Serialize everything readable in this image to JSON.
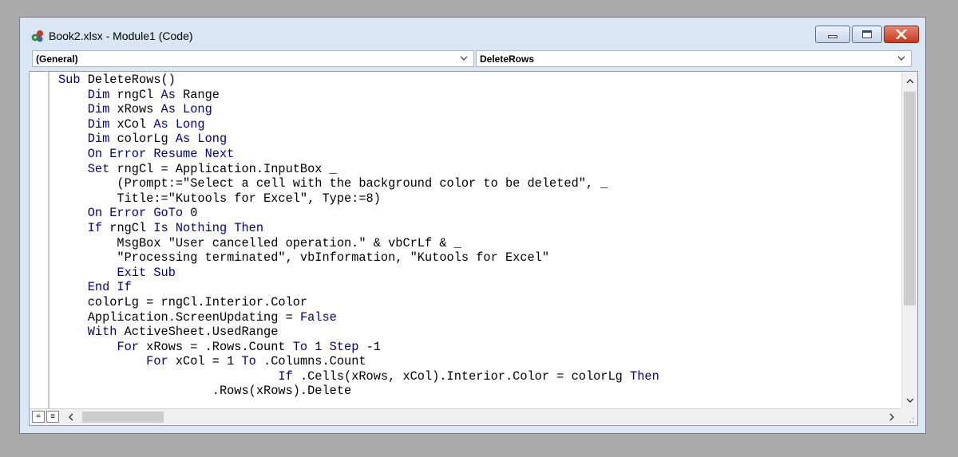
{
  "window": {
    "title": "Book2.xlsx - Module1 (Code)"
  },
  "toolbar": {
    "object_combo": "(General)",
    "procedure_combo": "DeleteRows"
  },
  "code": {
    "lines": [
      [
        [
          "kw",
          "Sub "
        ],
        [
          "t",
          "DeleteRows()"
        ]
      ],
      [
        [
          "t",
          "    "
        ],
        [
          "kw",
          "Dim "
        ],
        [
          "t",
          "rngCl "
        ],
        [
          "kw",
          "As "
        ],
        [
          "t",
          "Range"
        ]
      ],
      [
        [
          "t",
          "    "
        ],
        [
          "kw",
          "Dim "
        ],
        [
          "t",
          "xRows "
        ],
        [
          "kw",
          "As Long"
        ]
      ],
      [
        [
          "t",
          "    "
        ],
        [
          "kw",
          "Dim "
        ],
        [
          "t",
          "xCol "
        ],
        [
          "kw",
          "As Long"
        ]
      ],
      [
        [
          "t",
          "    "
        ],
        [
          "kw",
          "Dim "
        ],
        [
          "t",
          "colorLg "
        ],
        [
          "kw",
          "As Long"
        ]
      ],
      [
        [
          "t",
          "    "
        ],
        [
          "kw",
          "On Error Resume Next"
        ]
      ],
      [
        [
          "t",
          "    "
        ],
        [
          "kw",
          "Set "
        ],
        [
          "t",
          "rngCl = Application.InputBox _"
        ]
      ],
      [
        [
          "t",
          "        (Prompt:=\"Select a cell with the background color to be deleted\", _"
        ]
      ],
      [
        [
          "t",
          "        Title:=\"Kutools for Excel\", Type:=8)"
        ]
      ],
      [
        [
          "t",
          "    "
        ],
        [
          "kw",
          "On Error GoTo "
        ],
        [
          "t",
          "0"
        ]
      ],
      [
        [
          "t",
          "    "
        ],
        [
          "kw",
          "If "
        ],
        [
          "t",
          "rngCl "
        ],
        [
          "kw",
          "Is Nothing Then"
        ]
      ],
      [
        [
          "t",
          "        MsgBox \"User cancelled operation.\" & vbCrLf & _"
        ]
      ],
      [
        [
          "t",
          "        \"Processing terminated\", vbInformation, \"Kutools for Excel\""
        ]
      ],
      [
        [
          "t",
          "        "
        ],
        [
          "kw",
          "Exit Sub"
        ]
      ],
      [
        [
          "t",
          "    "
        ],
        [
          "kw",
          "End If"
        ]
      ],
      [
        [
          "t",
          "    colorLg = rngCl.Interior.Color"
        ]
      ],
      [
        [
          "t",
          "    Application.ScreenUpdating = "
        ],
        [
          "kw",
          "False"
        ]
      ],
      [
        [
          "t",
          "    "
        ],
        [
          "kw",
          "With "
        ],
        [
          "t",
          "ActiveSheet.UsedRange"
        ]
      ],
      [
        [
          "t",
          "        "
        ],
        [
          "kw",
          "For "
        ],
        [
          "t",
          "xRows = .Rows.Count "
        ],
        [
          "kw",
          "To "
        ],
        [
          "t",
          "1 "
        ],
        [
          "kw",
          "Step "
        ],
        [
          "t",
          "-1"
        ]
      ],
      [
        [
          "t",
          "            "
        ],
        [
          "kw",
          "For "
        ],
        [
          "t",
          "xCol = 1 "
        ],
        [
          "kw",
          "To "
        ],
        [
          "t",
          ".Columns.Count"
        ]
      ],
      [
        [
          "t",
          "                              "
        ],
        [
          "kw",
          "If "
        ],
        [
          "t",
          ".Cells(xRows, xCol).Interior.Color = colorLg "
        ],
        [
          "kw",
          "Then"
        ]
      ],
      [
        [
          "t",
          "                     .Rows(xRows).Delete"
        ]
      ]
    ]
  },
  "colors": {
    "keyword": "#00008b",
    "text": "#000000",
    "title_bar": "#dbe6f4",
    "close_button": "#c7391c"
  },
  "icons": {
    "app": "vba-module-icon",
    "minimize": "minimize-icon",
    "maximize": "maximize-icon",
    "close": "close-icon",
    "dropdown": "chevron-down-icon",
    "procedure_view": "procedure-view-icon",
    "full_module_view": "full-module-view-icon"
  }
}
